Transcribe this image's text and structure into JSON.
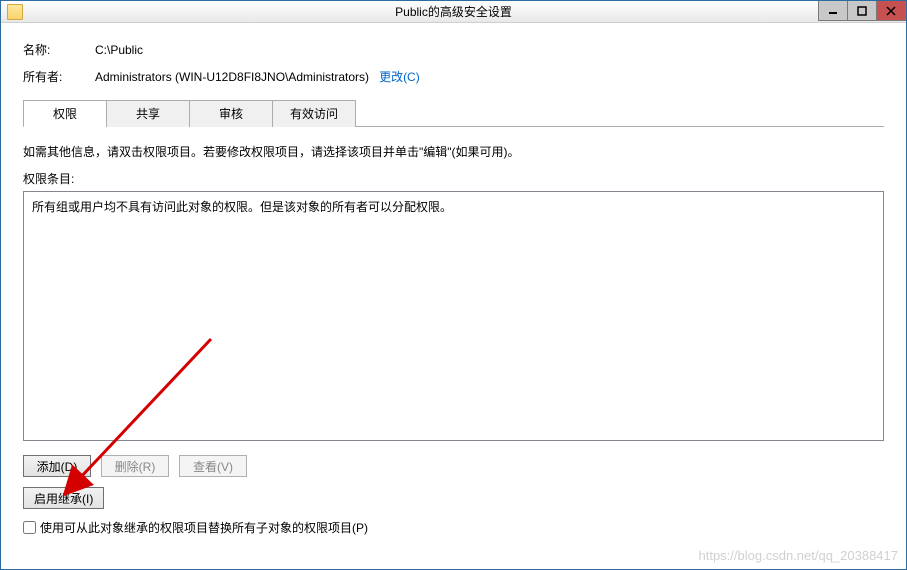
{
  "window": {
    "title": "Public的高级安全设置"
  },
  "info": {
    "name_label": "名称:",
    "name_value": "C:\\Public",
    "owner_label": "所有者:",
    "owner_value": "Administrators (WIN-U12D8FI8JNO\\Administrators)",
    "change_link": "更改(C)"
  },
  "tabs": {
    "items": [
      {
        "label": "权限",
        "active": true
      },
      {
        "label": "共享",
        "active": false
      },
      {
        "label": "审核",
        "active": false
      },
      {
        "label": "有效访问",
        "active": false
      }
    ]
  },
  "instruction": "如需其他信息，请双击权限项目。若要修改权限项目，请选择该项目并单击\"编辑\"(如果可用)。",
  "list_label": "权限条目:",
  "permissions_message": "所有组或用户均不具有访问此对象的权限。但是该对象的所有者可以分配权限。",
  "buttons": {
    "add": "添加(D)",
    "remove": "删除(R)",
    "view": "查看(V)",
    "enable_inherit": "启用继承(I)"
  },
  "checkbox": {
    "label": "使用可从此对象继承的权限项目替换所有子对象的权限项目(P)"
  },
  "watermark": "https://blog.csdn.net/qq_20388417"
}
